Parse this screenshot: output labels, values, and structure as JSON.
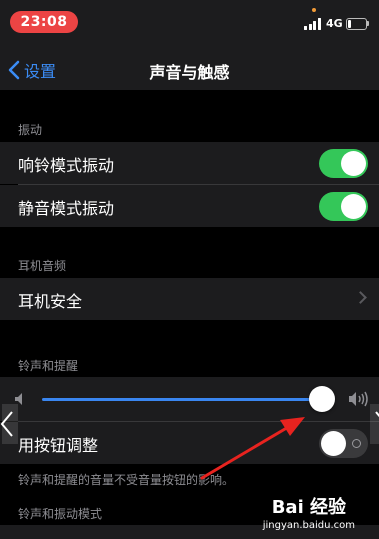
{
  "status_bar": {
    "time": "23:08",
    "network": "4G",
    "battery_level": 0.15
  },
  "nav": {
    "back_label": "设置",
    "title": "声音与触感"
  },
  "vibration": {
    "header": "振动",
    "items": [
      {
        "label": "响铃模式振动",
        "on": true
      },
      {
        "label": "静音模式振动",
        "on": true
      }
    ]
  },
  "headphones": {
    "header": "耳机音频",
    "items": [
      {
        "label": "耳机安全"
      }
    ]
  },
  "ringer": {
    "header": "铃声和提醒",
    "volume_level": 0.95,
    "change_with_buttons": {
      "label": "用按钮调整",
      "on": false
    },
    "footnote": "铃声和提醒的音量不受音量按钮的影响。"
  },
  "ringtone_patterns": {
    "header": "铃声和振动模式"
  },
  "watermark": {
    "brand": "Bai 经验",
    "site": "jingyan.baidu.com"
  },
  "colors": {
    "accent": "#3b8cf5",
    "toggle_on": "#34c759",
    "time_pill": "#ec4444",
    "annotation": "#e8231f"
  }
}
